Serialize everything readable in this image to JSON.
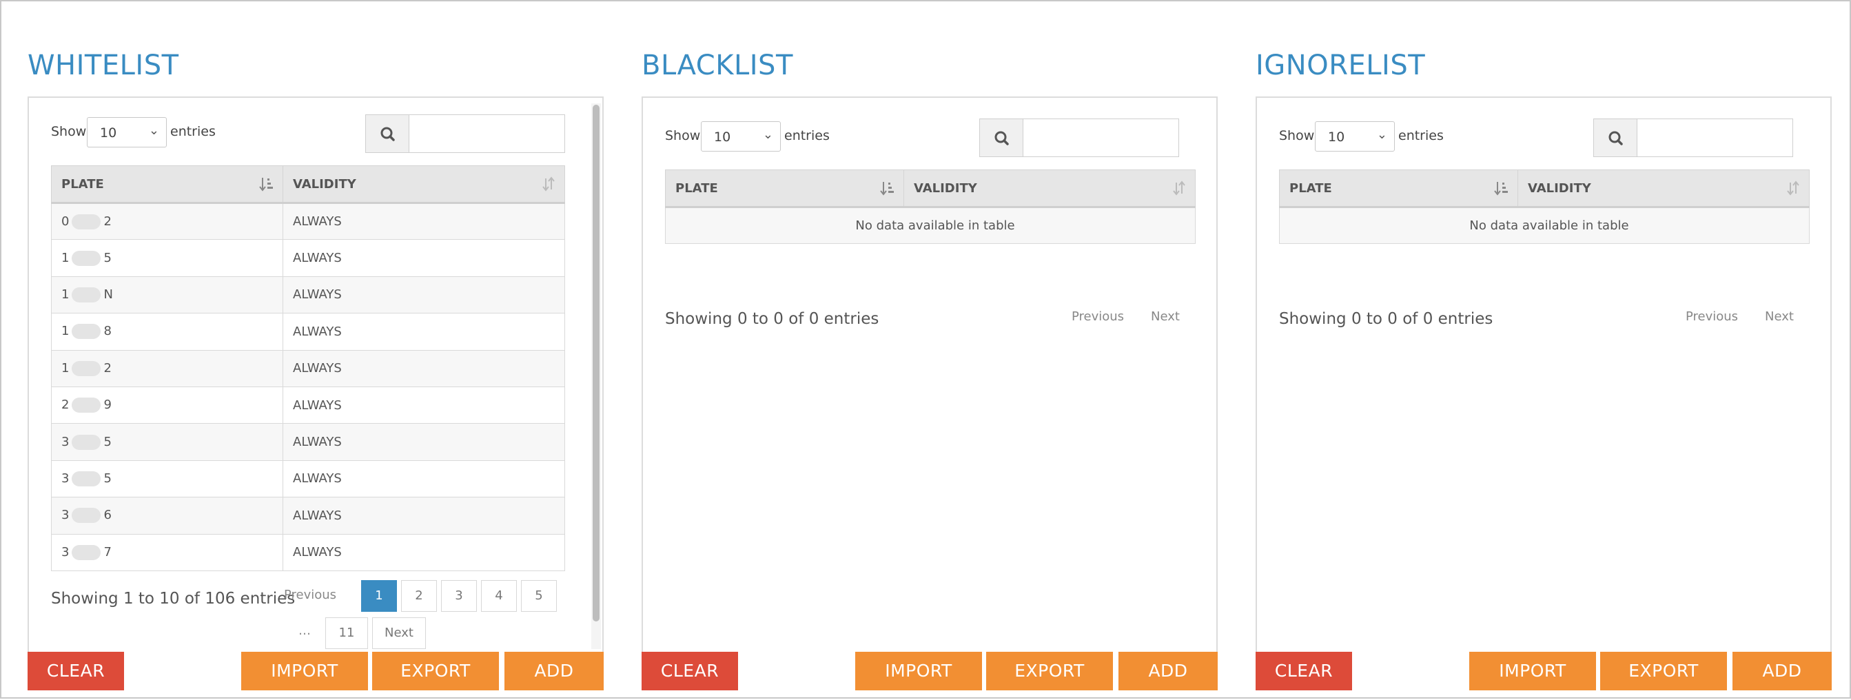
{
  "controls": {
    "show_label": "Show",
    "entries_label": "entries",
    "page_length": "10",
    "search_placeholder": ""
  },
  "columns": {
    "plate": "PLATE",
    "validity": "VALIDITY"
  },
  "buttons": {
    "clear": "CLEAR",
    "import": "IMPORT",
    "export": "EXPORT",
    "add": "ADD"
  },
  "pager": {
    "previous": "Previous",
    "next": "Next",
    "ellipsis": "…"
  },
  "whitelist": {
    "title": "WHITELIST",
    "rows": [
      {
        "plate_start": "0",
        "plate_end": "2",
        "validity": "ALWAYS"
      },
      {
        "plate_start": "1",
        "plate_end": "5",
        "validity": "ALWAYS"
      },
      {
        "plate_start": "1",
        "plate_end": "N",
        "validity": "ALWAYS"
      },
      {
        "plate_start": "1",
        "plate_end": "8",
        "validity": "ALWAYS"
      },
      {
        "plate_start": "1",
        "plate_end": "2",
        "validity": "ALWAYS"
      },
      {
        "plate_start": "2",
        "plate_end": "9",
        "validity": "ALWAYS"
      },
      {
        "plate_start": "3",
        "plate_end": "5",
        "validity": "ALWAYS"
      },
      {
        "plate_start": "3",
        "plate_end": "5",
        "validity": "ALWAYS"
      },
      {
        "plate_start": "3",
        "plate_end": "6",
        "validity": "ALWAYS"
      },
      {
        "plate_start": "3",
        "plate_end": "7",
        "validity": "ALWAYS"
      }
    ],
    "info": "Showing 1 to 10 of 106 entries",
    "pages": [
      "1",
      "2",
      "3",
      "4",
      "5"
    ],
    "last_page": "11",
    "active_page": "1"
  },
  "blacklist": {
    "title": "BLACKLIST",
    "empty_text": "No data available in table",
    "info": "Showing 0 to 0 of 0 entries"
  },
  "ignorelist": {
    "title": "IGNORELIST",
    "empty_text": "No data available in table",
    "info": "Showing 0 to 0 of 0 entries"
  },
  "colors": {
    "title_blue": "#3a8cc2",
    "clear_red": "#dd4b39",
    "action_orange": "#f28f33",
    "active_page_blue": "#3a8cc2"
  }
}
